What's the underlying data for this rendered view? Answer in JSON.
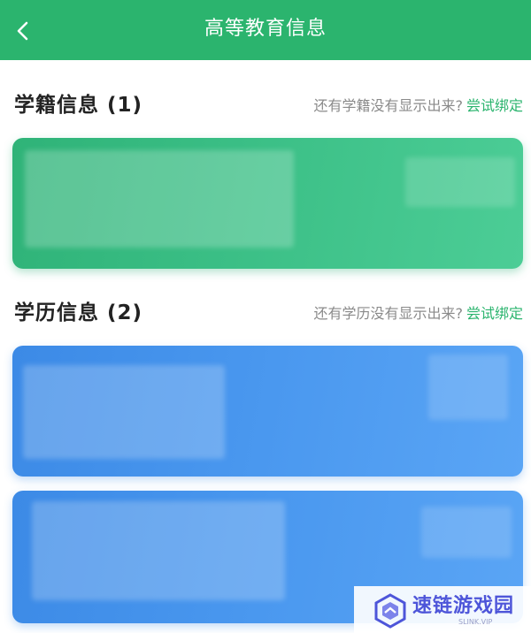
{
  "header": {
    "title": "高等教育信息"
  },
  "sections": [
    {
      "title": "学籍信息 (1)",
      "hint": "还有学籍没有显示出来?",
      "action": "尝试绑定"
    },
    {
      "title": "学历信息 (2)",
      "hint": "还有学历没有显示出来?",
      "action": "尝试绑定"
    }
  ],
  "watermark": {
    "text": "速链游戏园",
    "sub": "SLINK.VIP"
  },
  "colors": {
    "header_bg": "#2bb46e",
    "link": "#2bb46e",
    "card_green": "#3bbf86",
    "card_blue": "#4a98ef",
    "watermark": "#4d55d9"
  },
  "icons": {
    "back": "chevron-left-icon",
    "watermark_logo": "hexagon-logo-icon"
  }
}
